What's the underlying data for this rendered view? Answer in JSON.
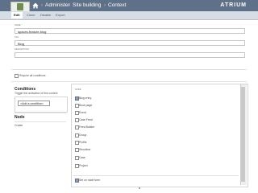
{
  "header": {
    "user": {
      "name": "admin"
    },
    "breadcrumbs": [
      "Administer",
      "Site building",
      "Context"
    ],
    "separator": "›",
    "brand": "ATRIUM"
  },
  "tabs": [
    "Edit",
    "Clone",
    "Disable",
    "Export"
  ],
  "form": {
    "name": {
      "label": "Name *",
      "value": "spaces-feature-blog"
    },
    "tag": {
      "label": "Tag",
      "value": "Blog"
    },
    "description": {
      "label": "Description",
      "value": ""
    },
    "require_all": {
      "label": "Require all conditions",
      "checked": false
    }
  },
  "conditions": {
    "title": "Conditions",
    "subtitle": "Trigger the activation of this context",
    "select_value": "<Add a condition>",
    "node_heading": "Node",
    "node_item": "Create"
  },
  "node_panel": {
    "title": "Node",
    "options": [
      {
        "label": "Blog entry",
        "checked": true
      },
      {
        "label": "Book page",
        "checked": false
      },
      {
        "label": "Event",
        "checked": false
      },
      {
        "label": "Case Feed",
        "checked": false
      },
      {
        "label": "Feed Builder",
        "checked": false
      },
      {
        "label": "Group",
        "checked": false
      },
      {
        "label": "Profile",
        "checked": false
      },
      {
        "label": "Shoutbox",
        "checked": false
      },
      {
        "label": "Case",
        "checked": false
      },
      {
        "label": "Project",
        "checked": false
      }
    ],
    "node_form": {
      "label": "Set on node form",
      "checked": true
    }
  },
  "colors": {
    "header": "#5f7189",
    "tabbar": "#d7dde4"
  }
}
